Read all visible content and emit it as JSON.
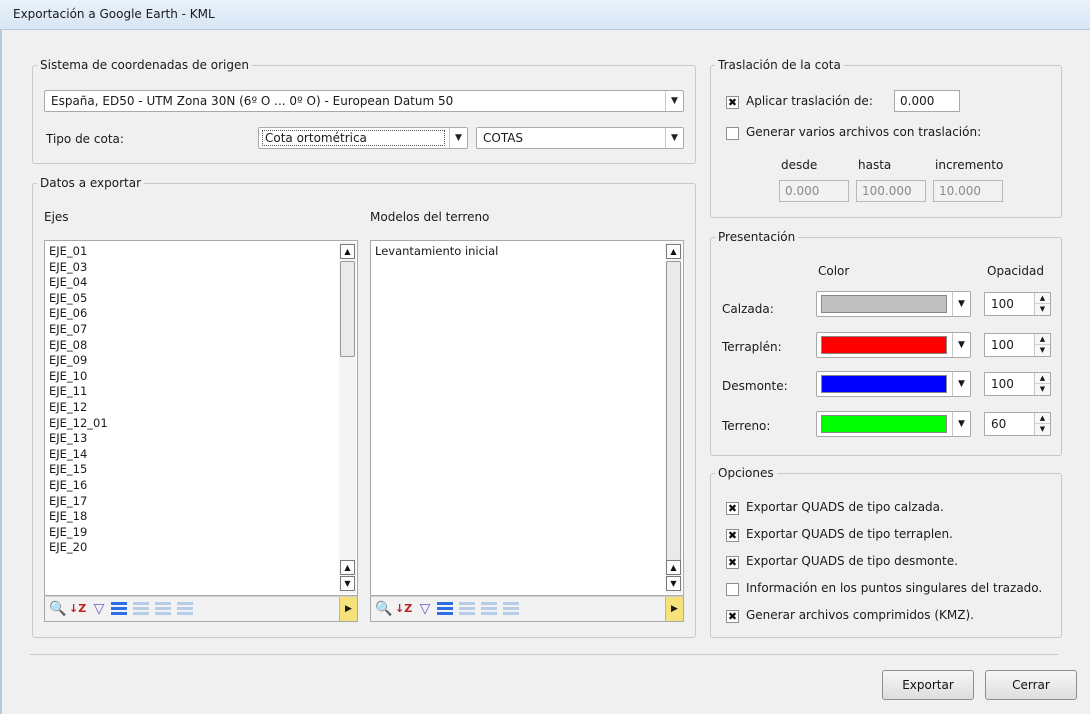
{
  "window": {
    "title": "Exportación a Google Earth - KML"
  },
  "origen": {
    "legend": "Sistema de coordenadas de origen",
    "sistema": "España, ED50 - UTM Zona 30N (6º O ... 0º O) - European Datum 50",
    "tipo_cota_label": "Tipo de cota:",
    "tipo_cota": "Cota ortométrica",
    "capa": "COTAS"
  },
  "datos": {
    "legend": "Datos a exportar",
    "ejes_label": "Ejes",
    "modelos_label": "Modelos del terreno",
    "ejes": [
      "EJE_01",
      "EJE_03",
      "EJE_04",
      "EJE_05",
      "EJE_06",
      "EJE_07",
      "EJE_08",
      "EJE_09",
      "EJE_10",
      "EJE_11",
      "EJE_12",
      "EJE_12_01",
      "EJE_13",
      "EJE_14",
      "EJE_15",
      "EJE_16",
      "EJE_17",
      "EJE_18",
      "EJE_19",
      "EJE_20"
    ],
    "modelos": [
      "Levantamiento inicial"
    ]
  },
  "traslacion": {
    "legend": "Traslación de la cota",
    "aplicar_label": "Aplicar traslación de:",
    "aplicar_checked": true,
    "valor": "0.000",
    "varios_label": "Generar varios archivos con traslación:",
    "varios_checked": false,
    "desde_label": "desde",
    "hasta_label": "hasta",
    "incremento_label": "incremento",
    "desde": "0.000",
    "hasta": "100.000",
    "incremento": "10.000"
  },
  "presentacion": {
    "legend": "Presentación",
    "color_header": "Color",
    "opacidad_header": "Opacidad",
    "rows": [
      {
        "label": "Calzada:",
        "color": "#c0c0c0",
        "opacidad": "100"
      },
      {
        "label": "Terraplén:",
        "color": "#ff0000",
        "opacidad": "100"
      },
      {
        "label": "Desmonte:",
        "color": "#0000ff",
        "opacidad": "100"
      },
      {
        "label": "Terreno:",
        "color": "#00ff00",
        "opacidad": "60"
      }
    ]
  },
  "opciones": {
    "legend": "Opciones",
    "items": [
      {
        "label": "Exportar QUADS de tipo calzada.",
        "checked": true
      },
      {
        "label": "Exportar QUADS de tipo terraplen.",
        "checked": true
      },
      {
        "label": "Exportar QUADS de tipo desmonte.",
        "checked": true
      },
      {
        "label": "Información en los puntos singulares del trazado.",
        "checked": false
      },
      {
        "label": "Generar archivos comprimidos (KMZ).",
        "checked": true
      }
    ]
  },
  "buttons": {
    "exportar": "Exportar",
    "cerrar": "Cerrar"
  },
  "icons": {
    "check_mark": "✖",
    "arrow_down": "▼",
    "arrow_up": "▲",
    "arrow_right": "▶"
  }
}
